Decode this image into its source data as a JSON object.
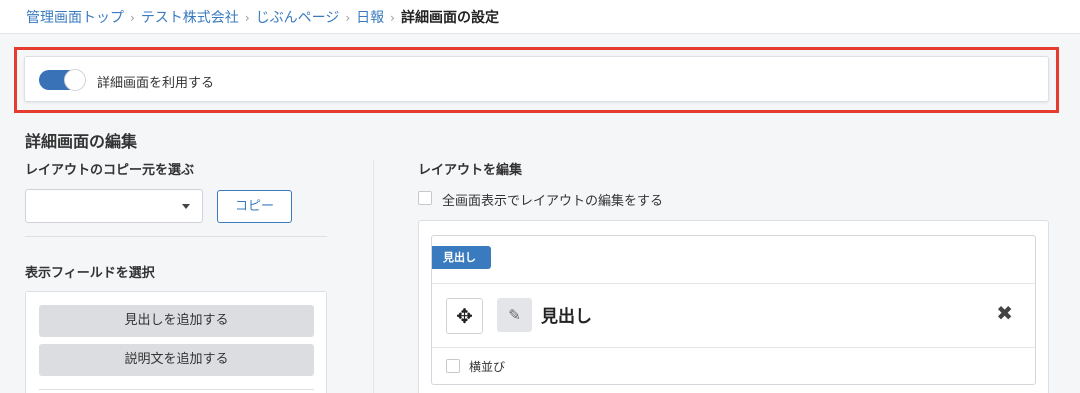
{
  "breadcrumb": {
    "items": [
      "管理画面トップ",
      "テスト株式会社",
      "じぶんページ",
      "日報"
    ],
    "current": "詳細画面の設定",
    "separator": "›"
  },
  "toggle": {
    "label": "詳細画面を利用する",
    "on": true
  },
  "editor": {
    "title": "詳細画面の編集",
    "copy_source_label": "レイアウトのコピー元を選ぶ",
    "copy_select_value": "",
    "copy_button": "コピー",
    "fields_label": "表示フィールドを選択",
    "add_heading_button": "見出しを追加する",
    "add_description_button": "説明文を追加する"
  },
  "layout": {
    "label": "レイアウトを編集",
    "fullscreen_checkbox": "全画面表示でレイアウトの編集をする",
    "block": {
      "badge": "見出し",
      "heading": "見出し",
      "inline_checkbox": "横並び"
    }
  },
  "icons": {
    "move": "move-icon",
    "edit": "edit-icon",
    "close": "close-icon",
    "caret": "chevron-down-icon"
  },
  "colors": {
    "accent": "#3a7bbf",
    "toggle_on": "#3a72b8",
    "highlight": "#e53c2e"
  }
}
